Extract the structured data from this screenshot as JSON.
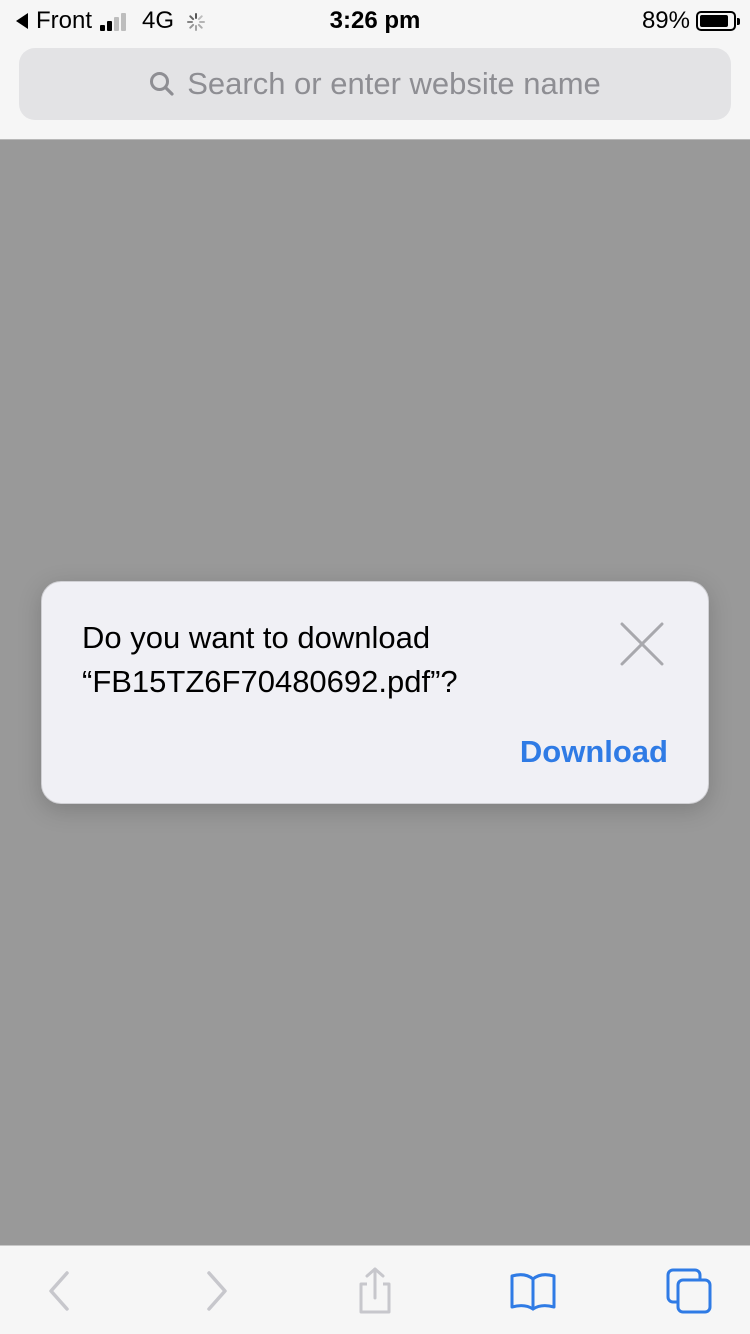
{
  "status_bar": {
    "back_app": "Front",
    "network": "4G",
    "time": "3:26 pm",
    "battery_percent": "89%",
    "battery_level": 0.89,
    "signal_bars": 2,
    "signal_total": 4
  },
  "search": {
    "placeholder": "Search or enter website name",
    "icon": "search-icon"
  },
  "dialog": {
    "line1": "Do you want to download",
    "line2": "“FB15TZ6F70480692.pdf”?",
    "download_label": "Download",
    "close_icon": "close-icon"
  },
  "toolbar": {
    "icons": [
      "back-icon",
      "forward-icon",
      "share-icon",
      "bookmarks-icon",
      "tabs-icon"
    ]
  },
  "colors": {
    "accent": "#2f7be5",
    "disabled": "#c7c7cc",
    "overlay": "#999999",
    "dialog_bg": "#f0f0f5"
  }
}
